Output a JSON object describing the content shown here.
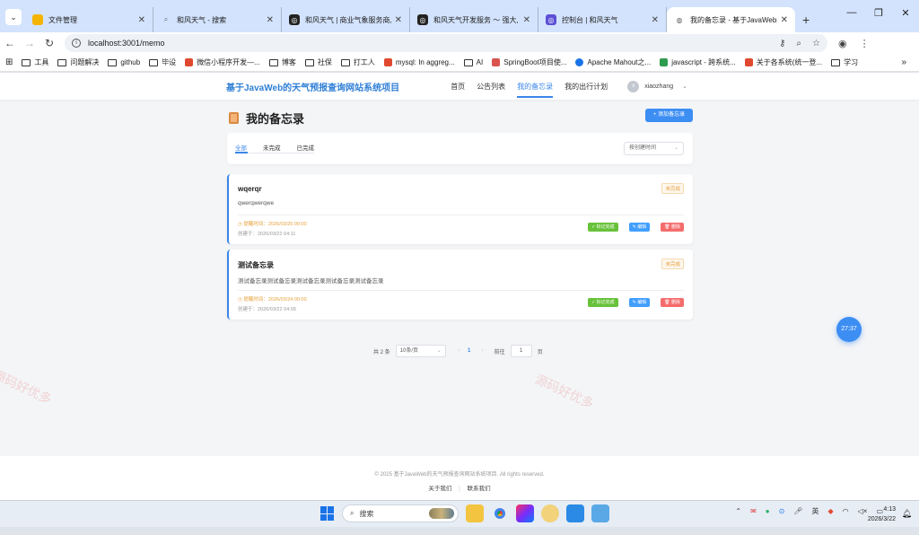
{
  "browser": {
    "tabs": [
      {
        "label": "文件管理",
        "icon": "folder-icon",
        "color": "#f4b400"
      },
      {
        "label": "和风天气 - 搜索",
        "icon": "search-icon",
        "color": "#5f6368"
      },
      {
        "label": "和风天气 | 商业气象服务商, 天",
        "icon": "qweather-icon",
        "color": "#222222"
      },
      {
        "label": "和风天气开发服务 ～ 强大, 丰富",
        "icon": "qweather-icon",
        "color": "#222222"
      },
      {
        "label": "控制台 | 和风天气",
        "icon": "qweather-console-icon",
        "color": "#5b4fd6"
      },
      {
        "label": "我的备忘录 - 基于JavaWeb的天",
        "icon": "globe-icon",
        "color": "#5f6368",
        "active": true
      }
    ],
    "url": "localhost:3001/memo",
    "bookmarks": [
      {
        "label": "工具",
        "type": "folder"
      },
      {
        "label": "问题解决",
        "type": "folder"
      },
      {
        "label": "github",
        "type": "folder"
      },
      {
        "label": "毕设",
        "type": "folder"
      },
      {
        "label": "微信小程序开发—...",
        "type": "csdn",
        "color": "#e0492f"
      },
      {
        "label": "博客",
        "type": "folder"
      },
      {
        "label": "社保",
        "type": "folder"
      },
      {
        "label": "打工人",
        "type": "folder"
      },
      {
        "label": "mysql: In aggreg...",
        "type": "csdn",
        "color": "#e0492f"
      },
      {
        "label": "AI",
        "type": "folder"
      },
      {
        "label": "SpringBoot项目使...",
        "type": "site",
        "color": "#d9534f"
      },
      {
        "label": "Apache Mahout之...",
        "type": "site",
        "color": "#1a73e8"
      },
      {
        "label": "javascript - 跨系统...",
        "type": "sf",
        "color": "#2e9c4e"
      },
      {
        "label": "关于各系统(统一登...",
        "type": "csdn",
        "color": "#e0492f"
      },
      {
        "label": "学习",
        "type": "folder"
      }
    ],
    "bookmarks_more": "»"
  },
  "site": {
    "brand": "基于JavaWeb的天气预报查询网站系统项目",
    "nav": [
      {
        "label": "首页"
      },
      {
        "label": "公告列表"
      },
      {
        "label": "我的备忘录",
        "active": true
      },
      {
        "label": "我的出行计划"
      }
    ],
    "user": {
      "avatar_text": "x",
      "name": "xiaozhang"
    }
  },
  "memo": {
    "title": "我的备忘录",
    "add_label": "+ 添加备忘录",
    "filter_tabs": [
      "全部",
      "未完成",
      "已完成"
    ],
    "sort_placeholder": "按创建时间",
    "items": [
      {
        "title": "wqerqr",
        "status": "未完成",
        "content": "qwerqwerqwe",
        "deadline": "◷ 提醒时间：2026/03/25 00:00",
        "created": "创建于：2026/03/22 04:11",
        "btn_done": "✓ 标记完成",
        "btn_edit": "✎ 编辑",
        "btn_delete": "🗑 删除"
      },
      {
        "title": "测试备忘录",
        "status": "未完成",
        "content": "测试备忘录测试备忘录测试备忘录测试备忘录测试备忘录",
        "deadline": "◷ 提醒时间：2026/03/24 00:00",
        "created": "创建于：2026/03/22 04:09",
        "btn_done": "✓ 标记完成",
        "btn_edit": "✎ 编辑",
        "btn_delete": "🗑 删除"
      }
    ],
    "pagination": {
      "total": "共 2 条",
      "page_size": "10条/页",
      "current": "1",
      "goto_label": "前往",
      "goto_value": "1",
      "page_suffix": "页"
    }
  },
  "watermark": "源码好优多",
  "timer": "27:37",
  "footer": {
    "copyright": "© 2025 基于JavaWeb的天气预报查询网站系统项目. All rights reserved.",
    "links": [
      "关于我们",
      "联系我们"
    ]
  },
  "taskbar": {
    "search_placeholder": "搜索",
    "time": "4:13",
    "date": "2026/3/22"
  },
  "colors": {
    "accent": "#3a86e8",
    "warning": "#e6a23c",
    "success": "#67c23a",
    "danger": "#f56c6c"
  }
}
